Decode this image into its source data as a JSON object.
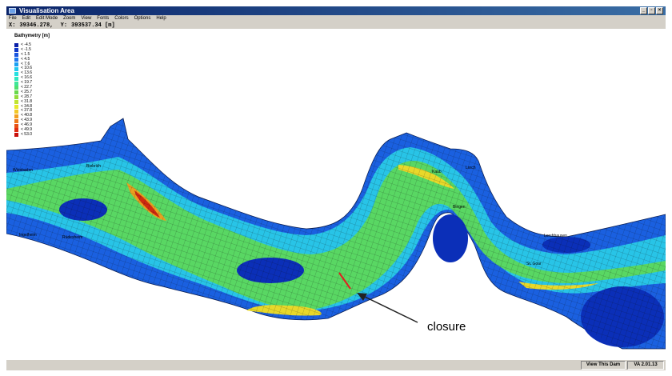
{
  "window": {
    "title": "Visualisation Area",
    "buttons": [
      "_",
      "▫",
      "×"
    ]
  },
  "menu": [
    "File",
    "Edit",
    "Edit Mode",
    "Zoom",
    "View",
    "Fonts",
    "Colors",
    "Options",
    "Help"
  ],
  "coords": {
    "x_label": "X:",
    "x_value": "39346.278,",
    "y_label": "Y:",
    "y_value": "393537.34 [m]"
  },
  "legend": {
    "title": "Bathymetry [m]",
    "items": [
      {
        "label": "< -4.5",
        "color": "#0a1fa8"
      },
      {
        "label": "< -1.5",
        "color": "#0f37c8"
      },
      {
        "label": "< 1.5",
        "color": "#1a55e0"
      },
      {
        "label": "< 4.5",
        "color": "#1f78ee"
      },
      {
        "label": "< 7.6",
        "color": "#1aa0f2"
      },
      {
        "label": "< 10.6",
        "color": "#22c8ee"
      },
      {
        "label": "< 13.6",
        "color": "#25e0e0"
      },
      {
        "label": "< 16.6",
        "color": "#30e8c0"
      },
      {
        "label": "< 19.7",
        "color": "#3ee69a"
      },
      {
        "label": "< 22.7",
        "color": "#4ee070"
      },
      {
        "label": "< 25.7",
        "color": "#6ad84c"
      },
      {
        "label": "< 28.7",
        "color": "#94dc3a"
      },
      {
        "label": "< 31.8",
        "color": "#c0e430"
      },
      {
        "label": "< 34.8",
        "color": "#e6e82a"
      },
      {
        "label": "< 37.8",
        "color": "#f2c828"
      },
      {
        "label": "< 40.8",
        "color": "#f2a020"
      },
      {
        "label": "< 43.9",
        "color": "#ee7818"
      },
      {
        "label": "< 46.9",
        "color": "#e85014"
      },
      {
        "label": "< 49.9",
        "color": "#e02a10"
      },
      {
        "label": "< 53.0",
        "color": "#c8100c"
      }
    ]
  },
  "river_labels": [
    "Wiesbaden",
    "Biebrich",
    "Ingelheim",
    "Rüdesheim",
    "Lorch",
    "Kaub",
    "Bingen",
    "Lorchhausen",
    "St. Goar"
  ],
  "annotation": "closure",
  "status": {
    "view": "View This Dam",
    "version": "VA 2.01.13"
  }
}
